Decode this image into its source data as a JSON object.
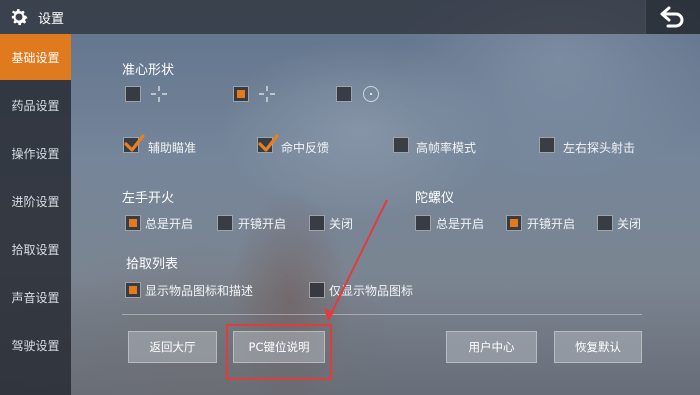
{
  "header": {
    "title": "设置",
    "gear_icon": "gear-icon",
    "back_icon": "return-arrow-icon"
  },
  "sidebar": {
    "items": [
      {
        "label": "基础设置",
        "active": true
      },
      {
        "label": "药品设置"
      },
      {
        "label": "操作设置"
      },
      {
        "label": "进阶设置"
      },
      {
        "label": "拾取设置"
      },
      {
        "label": "声音设置"
      },
      {
        "label": "驾驶设置"
      }
    ]
  },
  "crosshair": {
    "heading": "准心形状",
    "selected_index": 1
  },
  "options": [
    {
      "label": "辅助瞄准",
      "checked": true
    },
    {
      "label": "命中反馈",
      "checked": true
    },
    {
      "label": "高帧率模式",
      "checked": false
    },
    {
      "label": "左右探头射击",
      "checked": false
    }
  ],
  "left_fire": {
    "heading": "左手开火",
    "choices": [
      "总是开启",
      "开镜开启",
      "关闭"
    ],
    "selected": 0
  },
  "gyroscope": {
    "heading": "陀螺仪",
    "choices": [
      "总是开启",
      "开镜开启",
      "关闭"
    ],
    "selected": 1
  },
  "pickup_list": {
    "heading": "拾取列表",
    "choices": [
      "显示物品图标和描述",
      "仅显示物品图标"
    ],
    "selected": 0
  },
  "buttons": {
    "back_lobby": "返回大厅",
    "pc_keys": "PC键位说明",
    "user_center": "用户中心",
    "restore": "恢复默认"
  },
  "colors": {
    "accent": "#e07a1f",
    "highlight": "#e23b3b"
  }
}
